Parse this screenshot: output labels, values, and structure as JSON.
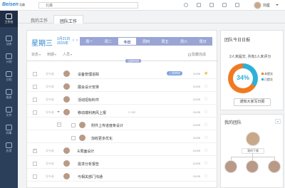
{
  "app": {
    "logo": "Beisen",
    "logo_sub": "北森"
  },
  "search": {
    "placeholder": "北森"
  },
  "user": {
    "name": "刘星"
  },
  "sidebar": {
    "items": [
      {
        "label": "工作台",
        "icon": "desk-icon",
        "active": true
      },
      {
        "label": "动态",
        "icon": "feed-icon"
      },
      {
        "label": "计划",
        "icon": "plan-icon"
      },
      {
        "label": "日程",
        "icon": "calendar-icon"
      },
      {
        "label": "报表",
        "icon": "report-icon"
      },
      {
        "label": "文件",
        "icon": "file-icon"
      },
      {
        "label": "同事",
        "icon": "colleague-icon"
      },
      {
        "label": "应用",
        "icon": "apps-icon"
      }
    ]
  },
  "tabs": [
    {
      "label": "我的工作",
      "active": false
    },
    {
      "label": "团队工作",
      "active": true
    }
  ],
  "header": {
    "weekday": "星期三",
    "date_line1": "1月21日",
    "date_line2": "2015年",
    "prev": "‹",
    "next": "›"
  },
  "weekbar": [
    "周一",
    "周二",
    "今日",
    "周四",
    "周五",
    "周六",
    "周日"
  ],
  "weekbar_active_index": 2,
  "filters": {
    "status": "状态",
    "sort": "到期",
    "people": "人员"
  },
  "hide_done": "隐藏完成",
  "now_label": "当前时间",
  "tasks": [
    {
      "owner": "发布者",
      "title": "设备管理追踪",
      "badge": "上线审核",
      "due": "01/05",
      "starred": true,
      "checked": false
    },
    {
      "owner": "发布者",
      "title": "展会设计安排",
      "badge": "",
      "due": "01/05",
      "starred": false,
      "checked": false
    },
    {
      "owner": "发布者",
      "title": "活动招标料件",
      "badge": "",
      "due": "01/05",
      "starred": false,
      "checked": false
    },
    {
      "owner": "发布者",
      "title": "移动端利用风上报",
      "badge": "",
      "due": "01/05",
      "starred": false,
      "checked": false,
      "subicons": "☐ 0/2"
    },
    {
      "owner": "",
      "title": "附件上传进度条设计",
      "badge": "",
      "due": "01/05",
      "starred": false,
      "checked": false,
      "sub": true
    },
    {
      "owner": "",
      "title": "加收更多优化",
      "badge": "",
      "due": "01/05",
      "starred": false,
      "checked": false,
      "sub": true
    },
    {
      "owner": "发布者",
      "title": "E周面设计",
      "badge": "",
      "due": "01/05",
      "starred": false,
      "checked": true
    },
    {
      "owner": "发布者",
      "title": "需求分析报告",
      "badge": "",
      "due": "01/05",
      "starred": false,
      "checked": false
    },
    {
      "owner": "发布者",
      "title": "与相关部门沟通",
      "badge": "",
      "due": "01/05",
      "starred": false,
      "checked": false
    }
  ],
  "panel_daily": {
    "title": "团队今日日报",
    "stat": "2人未提交, 共有1人未评分",
    "percent": "34%",
    "percent_value": 34,
    "legend": [
      {
        "label": "未提交",
        "color": "#f07a22"
      },
      {
        "label": "已提交",
        "color": "#2fb0d8"
      }
    ],
    "button": "通知大家写日报"
  },
  "panel_team": {
    "title": "我的团队",
    "leader_label": "我的下属"
  },
  "colors": {
    "accent": "#2b84cf",
    "weekbar": "#9aa5d6",
    "sidebar": "#2b3e5a",
    "orange": "#f07a22",
    "cyan": "#2fb0d8"
  }
}
